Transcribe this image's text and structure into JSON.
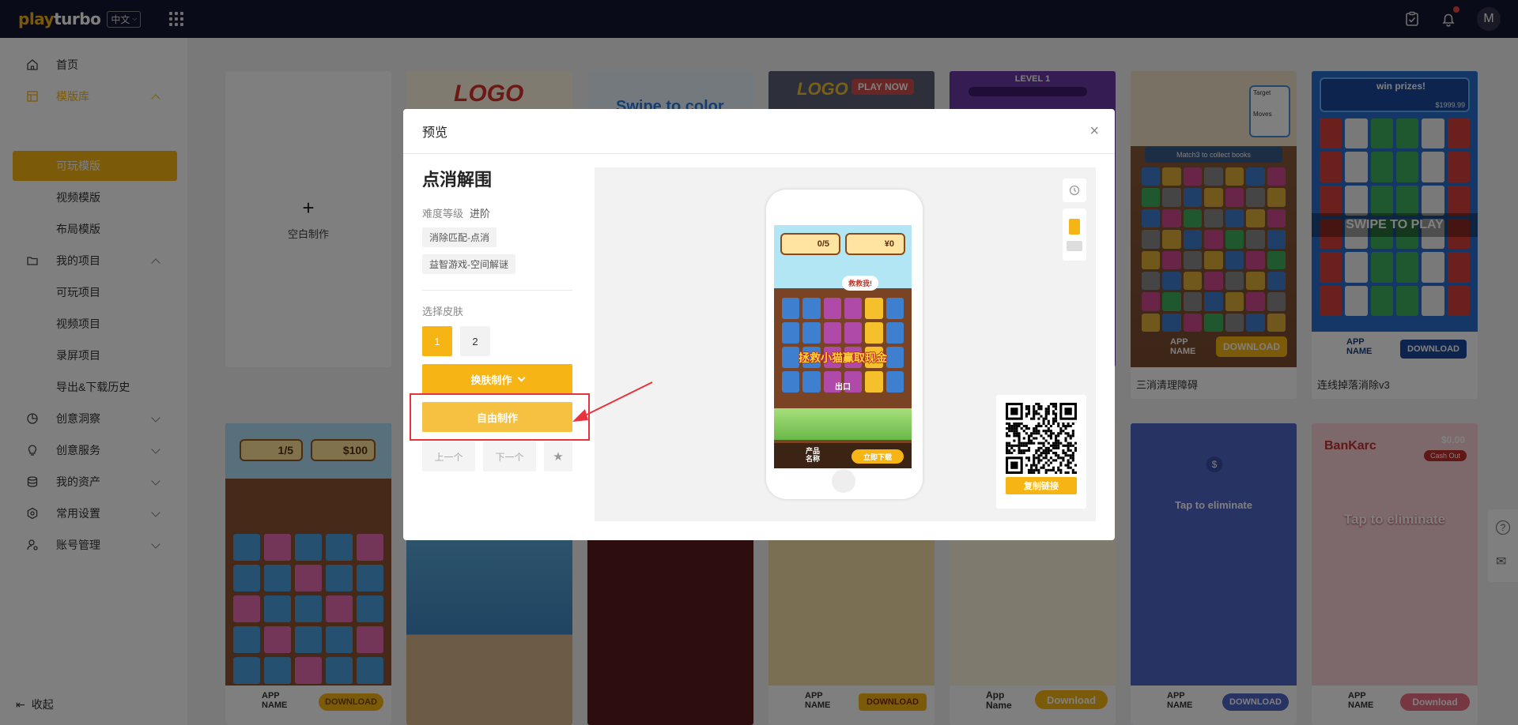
{
  "topbar": {
    "logo_a": "play",
    "logo_b": "turbo",
    "language": "中文",
    "avatar_initial": "M"
  },
  "sidebar": {
    "items": [
      {
        "label": "首页"
      },
      {
        "label": "模版库"
      },
      {
        "label": "可玩模版"
      },
      {
        "label": "视频模版"
      },
      {
        "label": "布局模版"
      },
      {
        "label": "我的项目"
      },
      {
        "label": "可玩项目"
      },
      {
        "label": "视频项目"
      },
      {
        "label": "录屏项目"
      },
      {
        "label": "导出&下载历史"
      },
      {
        "label": "创意洞察"
      },
      {
        "label": "创意服务"
      },
      {
        "label": "我的资产"
      },
      {
        "label": "常用设置"
      },
      {
        "label": "账号管理"
      }
    ],
    "collapse_label": "收起"
  },
  "grid": {
    "blank_card_label": "空白制作",
    "blank_card_plus": "+",
    "card_titles": [
      "三消清理障碍",
      "连线掉落消除v3"
    ],
    "thumb_texts": {
      "logo": "LOGO",
      "swipe_color": "Swipe to color",
      "play_now": "PLAY NOW",
      "level": "LEVEL 1",
      "collect_books": "Match3 to collect books",
      "target": "Target",
      "moves": "Moves",
      "win_prizes": "win prizes!",
      "prize_amount": "$1999.99",
      "swipe_to_play": "SWIPE TO PLAY",
      "app_name": "APP NAME",
      "download": "DOWNLOAD",
      "download_mixed": "Download",
      "app_name_mixed": "App Name",
      "score_moves": "1/5",
      "score_money": "$100",
      "tap_eliminate": "Tap to eliminate",
      "bankarc": "BanKarc",
      "cash_amount": "$0.00",
      "cash_out": "Cash Out",
      "dollar_sign": "$"
    }
  },
  "modal": {
    "title": "预览",
    "close": "×",
    "template_name": "点消解围",
    "difficulty_label": "难度等级",
    "difficulty_value": "进阶",
    "tags": [
      "消除匹配-点消",
      "益智游戏-空间解谜"
    ],
    "skin_label": "选择皮肤",
    "skins": [
      "1",
      "2"
    ],
    "swap_button": "换肤制作",
    "free_button": "自由制作",
    "prev_button": "上一个",
    "next_button": "下一个",
    "star": "★",
    "copy_link_button": "复制链接",
    "game_preview": {
      "moves": "0/5",
      "money": "¥0",
      "speech": "救救我!",
      "headline": "拯救小猫赢取现金",
      "exit_label": "出口",
      "app_name": "产品名称",
      "cta": "立即下载"
    }
  },
  "colors": {
    "accent": "#f6b514",
    "topbar": "#151631",
    "highlight": "#e8333d"
  }
}
